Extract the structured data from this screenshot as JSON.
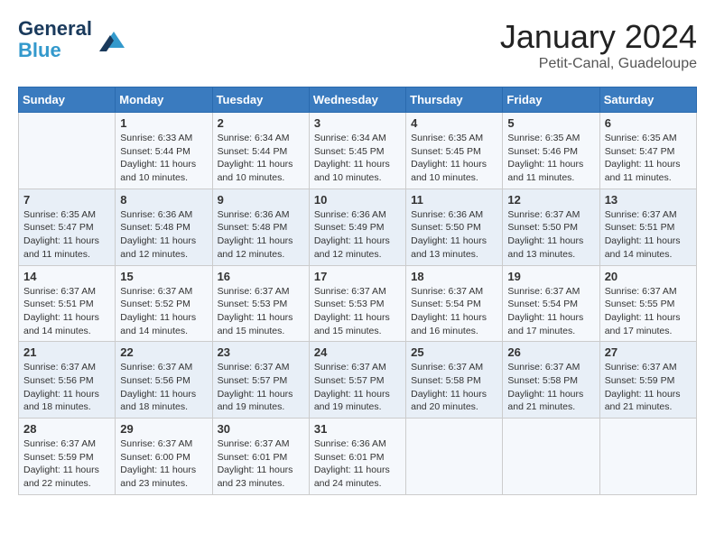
{
  "header": {
    "logo_line1": "General",
    "logo_line2": "Blue",
    "month": "January 2024",
    "location": "Petit-Canal, Guadeloupe"
  },
  "days_of_week": [
    "Sunday",
    "Monday",
    "Tuesday",
    "Wednesday",
    "Thursday",
    "Friday",
    "Saturday"
  ],
  "weeks": [
    [
      {
        "day": "",
        "info": ""
      },
      {
        "day": "1",
        "info": "Sunrise: 6:33 AM\nSunset: 5:44 PM\nDaylight: 11 hours\nand 10 minutes."
      },
      {
        "day": "2",
        "info": "Sunrise: 6:34 AM\nSunset: 5:44 PM\nDaylight: 11 hours\nand 10 minutes."
      },
      {
        "day": "3",
        "info": "Sunrise: 6:34 AM\nSunset: 5:45 PM\nDaylight: 11 hours\nand 10 minutes."
      },
      {
        "day": "4",
        "info": "Sunrise: 6:35 AM\nSunset: 5:45 PM\nDaylight: 11 hours\nand 10 minutes."
      },
      {
        "day": "5",
        "info": "Sunrise: 6:35 AM\nSunset: 5:46 PM\nDaylight: 11 hours\nand 11 minutes."
      },
      {
        "day": "6",
        "info": "Sunrise: 6:35 AM\nSunset: 5:47 PM\nDaylight: 11 hours\nand 11 minutes."
      }
    ],
    [
      {
        "day": "7",
        "info": "Sunrise: 6:35 AM\nSunset: 5:47 PM\nDaylight: 11 hours\nand 11 minutes."
      },
      {
        "day": "8",
        "info": "Sunrise: 6:36 AM\nSunset: 5:48 PM\nDaylight: 11 hours\nand 12 minutes."
      },
      {
        "day": "9",
        "info": "Sunrise: 6:36 AM\nSunset: 5:48 PM\nDaylight: 11 hours\nand 12 minutes."
      },
      {
        "day": "10",
        "info": "Sunrise: 6:36 AM\nSunset: 5:49 PM\nDaylight: 11 hours\nand 12 minutes."
      },
      {
        "day": "11",
        "info": "Sunrise: 6:36 AM\nSunset: 5:50 PM\nDaylight: 11 hours\nand 13 minutes."
      },
      {
        "day": "12",
        "info": "Sunrise: 6:37 AM\nSunset: 5:50 PM\nDaylight: 11 hours\nand 13 minutes."
      },
      {
        "day": "13",
        "info": "Sunrise: 6:37 AM\nSunset: 5:51 PM\nDaylight: 11 hours\nand 14 minutes."
      }
    ],
    [
      {
        "day": "14",
        "info": "Sunrise: 6:37 AM\nSunset: 5:51 PM\nDaylight: 11 hours\nand 14 minutes."
      },
      {
        "day": "15",
        "info": "Sunrise: 6:37 AM\nSunset: 5:52 PM\nDaylight: 11 hours\nand 14 minutes."
      },
      {
        "day": "16",
        "info": "Sunrise: 6:37 AM\nSunset: 5:53 PM\nDaylight: 11 hours\nand 15 minutes."
      },
      {
        "day": "17",
        "info": "Sunrise: 6:37 AM\nSunset: 5:53 PM\nDaylight: 11 hours\nand 15 minutes."
      },
      {
        "day": "18",
        "info": "Sunrise: 6:37 AM\nSunset: 5:54 PM\nDaylight: 11 hours\nand 16 minutes."
      },
      {
        "day": "19",
        "info": "Sunrise: 6:37 AM\nSunset: 5:54 PM\nDaylight: 11 hours\nand 17 minutes."
      },
      {
        "day": "20",
        "info": "Sunrise: 6:37 AM\nSunset: 5:55 PM\nDaylight: 11 hours\nand 17 minutes."
      }
    ],
    [
      {
        "day": "21",
        "info": "Sunrise: 6:37 AM\nSunset: 5:56 PM\nDaylight: 11 hours\nand 18 minutes."
      },
      {
        "day": "22",
        "info": "Sunrise: 6:37 AM\nSunset: 5:56 PM\nDaylight: 11 hours\nand 18 minutes."
      },
      {
        "day": "23",
        "info": "Sunrise: 6:37 AM\nSunset: 5:57 PM\nDaylight: 11 hours\nand 19 minutes."
      },
      {
        "day": "24",
        "info": "Sunrise: 6:37 AM\nSunset: 5:57 PM\nDaylight: 11 hours\nand 19 minutes."
      },
      {
        "day": "25",
        "info": "Sunrise: 6:37 AM\nSunset: 5:58 PM\nDaylight: 11 hours\nand 20 minutes."
      },
      {
        "day": "26",
        "info": "Sunrise: 6:37 AM\nSunset: 5:58 PM\nDaylight: 11 hours\nand 21 minutes."
      },
      {
        "day": "27",
        "info": "Sunrise: 6:37 AM\nSunset: 5:59 PM\nDaylight: 11 hours\nand 21 minutes."
      }
    ],
    [
      {
        "day": "28",
        "info": "Sunrise: 6:37 AM\nSunset: 5:59 PM\nDaylight: 11 hours\nand 22 minutes."
      },
      {
        "day": "29",
        "info": "Sunrise: 6:37 AM\nSunset: 6:00 PM\nDaylight: 11 hours\nand 23 minutes."
      },
      {
        "day": "30",
        "info": "Sunrise: 6:37 AM\nSunset: 6:01 PM\nDaylight: 11 hours\nand 23 minutes."
      },
      {
        "day": "31",
        "info": "Sunrise: 6:36 AM\nSunset: 6:01 PM\nDaylight: 11 hours\nand 24 minutes."
      },
      {
        "day": "",
        "info": ""
      },
      {
        "day": "",
        "info": ""
      },
      {
        "day": "",
        "info": ""
      }
    ]
  ]
}
